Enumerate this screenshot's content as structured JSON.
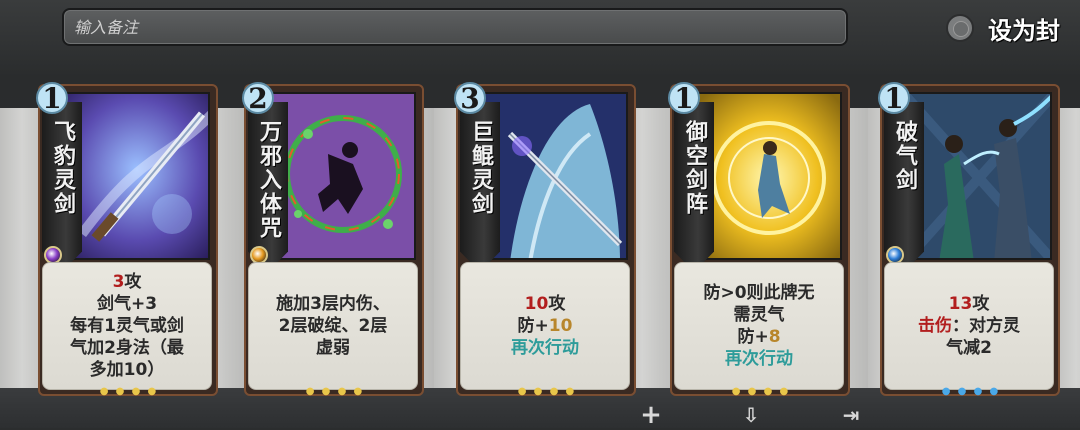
{
  "note": {
    "placeholder": "输入备注"
  },
  "seal": {
    "label": "设为封"
  },
  "cards": [
    {
      "cost": "1",
      "name": "飞豹灵剑",
      "gem_color": "#8a3fc8",
      "lines": [
        {
          "parts": [
            {
              "text": "3",
              "style": "red"
            },
            {
              "text": "攻",
              "style": ""
            }
          ]
        },
        {
          "parts": [
            {
              "text": "剑气+3",
              "style": ""
            }
          ]
        },
        {
          "parts": [
            {
              "text": "每有1灵气或剑",
              "style": ""
            }
          ]
        },
        {
          "parts": [
            {
              "text": "气加2身法（最",
              "style": ""
            }
          ]
        },
        {
          "parts": [
            {
              "text": "多加10）",
              "style": ""
            }
          ]
        }
      ]
    },
    {
      "cost": "2",
      "name": "万邪入体咒",
      "gem_color": "#e69a20",
      "lines": [
        {
          "parts": [
            {
              "text": "施加3层内伤、",
              "style": ""
            }
          ]
        },
        {
          "parts": [
            {
              "text": "2层破绽、2层",
              "style": ""
            }
          ]
        },
        {
          "parts": [
            {
              "text": "虚弱",
              "style": ""
            }
          ]
        }
      ]
    },
    {
      "cost": "3",
      "name": "巨鲲灵剑",
      "gem_color": "",
      "lines": [
        {
          "parts": [
            {
              "text": "10",
              "style": "red"
            },
            {
              "text": "攻",
              "style": ""
            }
          ]
        },
        {
          "parts": [
            {
              "text": "防+",
              "style": ""
            },
            {
              "text": "10",
              "style": "gold"
            }
          ]
        },
        {
          "parts": [
            {
              "text": "再次行动",
              "style": "teal"
            }
          ]
        }
      ]
    },
    {
      "cost": "1",
      "name": "御空剑阵",
      "gem_color": "",
      "lines": [
        {
          "parts": [
            {
              "text": "防>0则此牌无",
              "style": ""
            }
          ]
        },
        {
          "parts": [
            {
              "text": "需灵气",
              "style": ""
            }
          ]
        },
        {
          "parts": [
            {
              "text": "防+",
              "style": ""
            },
            {
              "text": "8",
              "style": "gold"
            }
          ]
        },
        {
          "parts": [
            {
              "text": "再次行动",
              "style": "teal"
            }
          ]
        }
      ]
    },
    {
      "cost": "1",
      "name": "破气剑",
      "gem_color": "#2f7fd8",
      "lines": [
        {
          "parts": [
            {
              "text": "13",
              "style": "red"
            },
            {
              "text": "攻",
              "style": ""
            }
          ]
        },
        {
          "parts": [
            {
              "text": "击伤",
              "style": "red"
            },
            {
              "text": "：对方灵",
              "style": ""
            }
          ]
        },
        {
          "parts": [
            {
              "text": "气减2",
              "style": ""
            }
          ]
        }
      ]
    }
  ],
  "toolbar": {
    "icons": [
      "plus-icon",
      "move-down-icon",
      "export-icon"
    ]
  }
}
